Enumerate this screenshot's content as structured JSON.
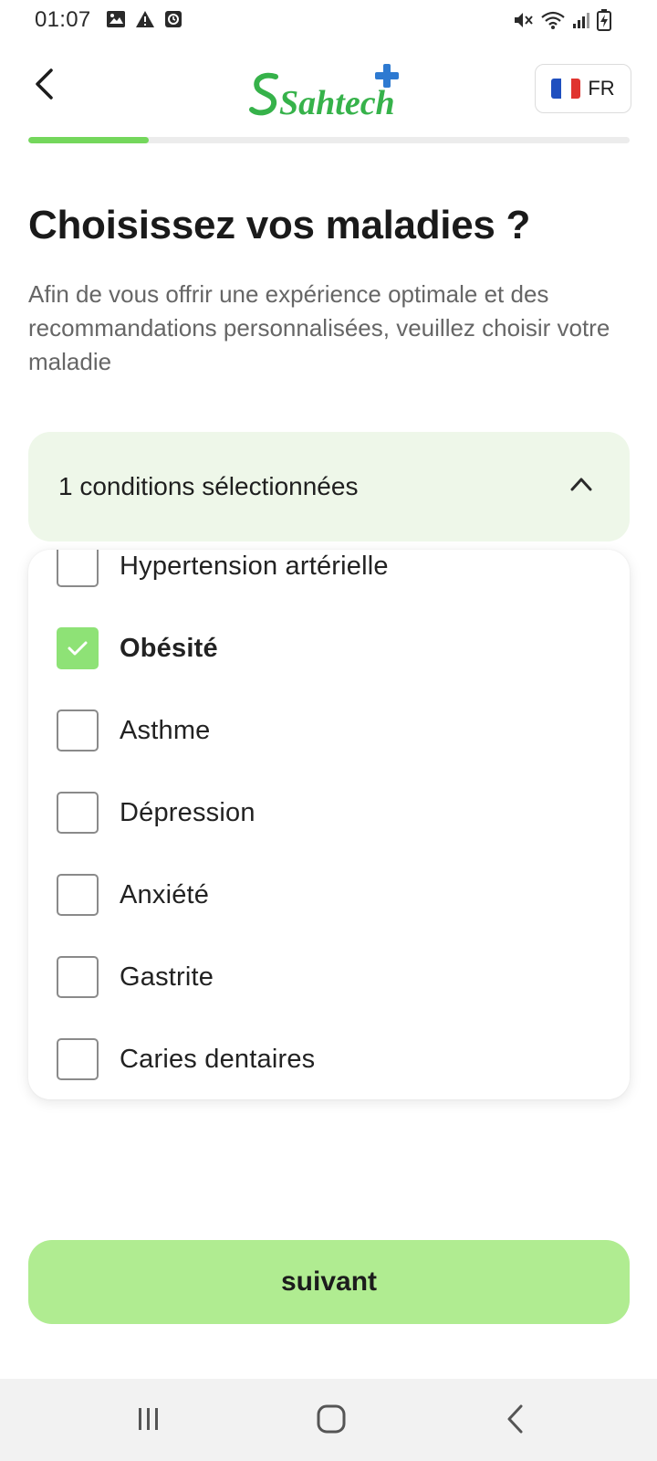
{
  "status_bar": {
    "time": "01:07",
    "notification_icons": [
      "image-icon",
      "warning-icon",
      "alarm-icon"
    ],
    "system_icons": [
      "mute-icon",
      "wifi-icon",
      "signal-icon",
      "battery-charging-icon"
    ]
  },
  "header": {
    "back_icon": "chevron-left-icon",
    "logo_text": "Sahtech",
    "language": {
      "code": "FR",
      "flag": "france-flag-icon"
    }
  },
  "progress": {
    "value": 0.2
  },
  "title": "Choisissez vos maladies ?",
  "description": "Afin de vous offrir une expérience optimale et des recommandations personnalisées, veuillez choisir votre maladie",
  "dropdown": {
    "summary": "1 conditions sélectionnées",
    "expanded": true,
    "items": [
      {
        "label": "Hypertension artérielle",
        "checked": false
      },
      {
        "label": "Obésité",
        "checked": true
      },
      {
        "label": "Asthme",
        "checked": false
      },
      {
        "label": "Dépression",
        "checked": false
      },
      {
        "label": "Anxiété",
        "checked": false
      },
      {
        "label": "Gastrite",
        "checked": false
      },
      {
        "label": "Caries dentaires",
        "checked": false
      }
    ]
  },
  "next_button": {
    "label": "suivant"
  },
  "nav_bar": {
    "buttons": [
      "recent-apps-icon",
      "home-icon",
      "back-icon"
    ]
  },
  "colors": {
    "accent_green": "#5cc449",
    "logo_green": "#36b24a",
    "logo_blue": "#2e7ad1",
    "progress_fill": "#74d75c",
    "checkbox_checked": "#8ee276",
    "dropdown_bg": "#eef7e9",
    "button_bg": "#b0ec91"
  }
}
